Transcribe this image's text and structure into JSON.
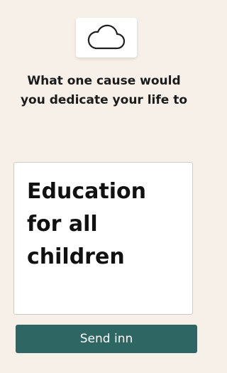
{
  "prompt": {
    "icon": "cloud-icon",
    "question": "What one cause would you dedicate your life to"
  },
  "answer": {
    "value": "Education for all children"
  },
  "actions": {
    "send_label": "Send inn"
  },
  "colors": {
    "background": "#f6f0e8",
    "button": "#2e6664"
  }
}
